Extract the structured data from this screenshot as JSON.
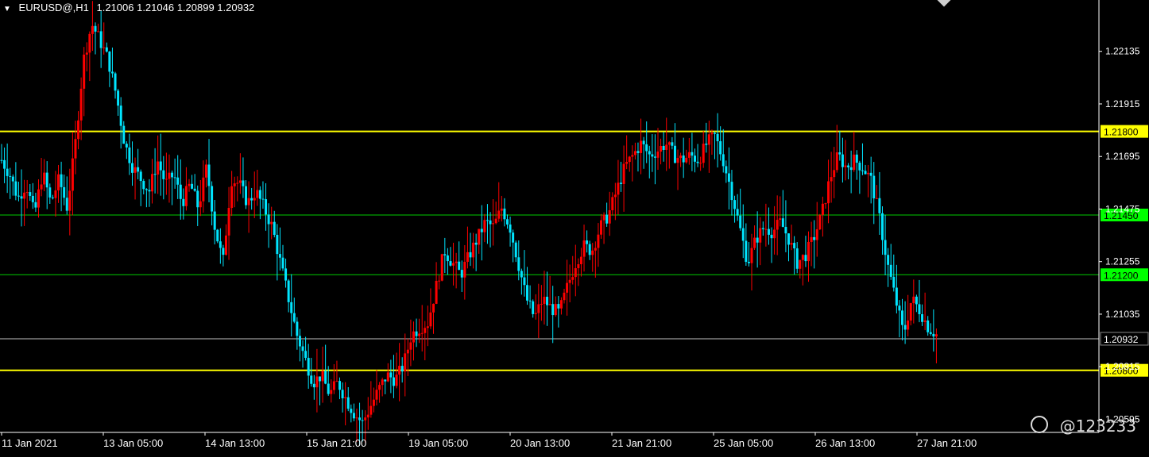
{
  "header": {
    "symbol": "EURUSD@,H1",
    "ohlc": "1.21006 1.21046 1.20899 1.20932"
  },
  "watermark": {
    "text": "@123233",
    "icon": "weibo-logo-icon"
  },
  "colors": {
    "background": "#000000",
    "bull": "#ff0000",
    "bear": "#00e5ff",
    "support_resistance": "#ffff00",
    "level_green": "#00ff00",
    "grid_line": "#33cc33",
    "current_price_line": "#c0c0c0",
    "axis": "#ffffff"
  },
  "chart_data": {
    "type": "candlestick",
    "symbol": "EURUSD@",
    "timeframe": "H1",
    "ylim": [
      1.2054,
      1.2235
    ],
    "y_ticks": [
      "1.22135",
      "1.21915",
      "1.21695",
      "1.21475",
      "1.21255",
      "1.21035",
      "1.20815",
      "1.20595"
    ],
    "x_ticks": [
      "11 Jan 2021",
      "13 Jan 05:00",
      "14 Jan 13:00",
      "15 Jan 21:00",
      "19 Jan 05:00",
      "20 Jan 13:00",
      "21 Jan 21:00",
      "25 Jan 05:00",
      "26 Jan 13:00",
      "27 Jan 21:00"
    ],
    "horizontal_levels": [
      {
        "value": 1.218,
        "label": "1.21800",
        "color": "#ffff00",
        "label_bg": "#ffff00",
        "label_fg": "#000000"
      },
      {
        "value": 1.2145,
        "label": "1.21450",
        "color": "#00cc00",
        "label_bg": "#00ff00",
        "label_fg": "#000000"
      },
      {
        "value": 1.212,
        "label": "1.21200",
        "color": "#00cc00",
        "label_bg": "#00ff00",
        "label_fg": "#000000"
      },
      {
        "value": 1.20932,
        "label": "1.20932",
        "color": "#c0c0c0",
        "label_bg": "#000000",
        "label_fg": "#ffffff"
      },
      {
        "value": 1.208,
        "label": "1.20800",
        "color": "#ffff00",
        "label_bg": "#ffff00",
        "label_fg": "#000000"
      }
    ],
    "close_path": [
      1.2168,
      1.2162,
      1.2152,
      1.2158,
      1.2145,
      1.2163,
      1.215,
      1.216,
      1.2148,
      1.2175,
      1.221,
      1.2225,
      1.2218,
      1.221,
      1.2195,
      1.2175,
      1.2165,
      1.216,
      1.2155,
      1.2168,
      1.2158,
      1.2162,
      1.215,
      1.2158,
      1.2148,
      1.2165,
      1.214,
      1.2125,
      1.216,
      1.2158,
      1.215,
      1.2155,
      1.2148,
      1.214,
      1.2125,
      1.211,
      1.2095,
      1.2085,
      1.2075,
      1.2078,
      1.207,
      1.2075,
      1.2068,
      1.2062,
      1.2058,
      1.2065,
      1.2072,
      1.2078,
      1.2076,
      1.2082,
      1.2095,
      1.2098,
      1.21,
      1.2115,
      1.213,
      1.2125,
      1.212,
      1.2128,
      1.2135,
      1.2142,
      1.214,
      1.2148,
      1.214,
      1.2125,
      1.211,
      1.2102,
      1.211,
      1.2106,
      1.2104,
      1.2115,
      1.2125,
      1.2132,
      1.213,
      1.214,
      1.2145,
      1.2155,
      1.2165,
      1.217,
      1.2175,
      1.217,
      1.2172,
      1.2175,
      1.217,
      1.2168,
      1.217,
      1.2168,
      1.2175,
      1.2178,
      1.2168,
      1.2155,
      1.214,
      1.2125,
      1.2135,
      1.214,
      1.2138,
      1.2142,
      1.2135,
      1.2125,
      1.2128,
      1.2135,
      1.2145,
      1.216,
      1.217,
      1.2165,
      1.2168,
      1.2165,
      1.216,
      1.2145,
      1.2125,
      1.211,
      1.2095,
      1.211,
      1.2105,
      1.2098,
      1.2095
    ]
  }
}
